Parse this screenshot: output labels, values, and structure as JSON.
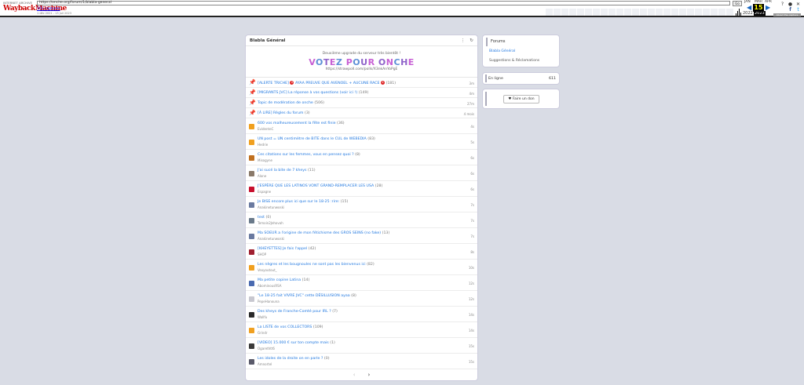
{
  "wayback": {
    "logo_small": "INTERNET ARCHIVE",
    "logo_big": "WaybackMachine",
    "url": "https://onche.org/forum/1/blabla-general",
    "go": "Go",
    "captures": "161 captures",
    "range": "1 déc 2021 - 13 Juil 2023",
    "months": [
      "JAN",
      "MAR",
      "APR"
    ],
    "day": "15",
    "year_prev": "2022",
    "year_cur": "2023",
    "about": "About this capture"
  },
  "forum": {
    "title": "Blabla Général",
    "banner_sub": "Deuxième upgrade du serveur très bientôt !",
    "vote_text": "VOTEZ POUR ONCHE",
    "vote_link": "https://strawpoll.com/polls/X3nkAnYoPgE",
    "pinned": [
      {
        "title": "[ALERTE TRICHE]",
        "badge": "X",
        "title2": "AYAA PREUVE QUE AVENOEL + AUCUNE RACE",
        "badge2": "X",
        "count": "(181)",
        "time": "3m",
        "pin": "green"
      },
      {
        "title": "[MIGRANTS JVC] La réponse à vos questions (voir ici !)",
        "count": "(149)",
        "time": "4m",
        "pin": "green"
      },
      {
        "title": "Topic de modération de onche",
        "count": "(506)",
        "time": "27m",
        "pin": "green"
      },
      {
        "title": "[À LIRE] Règles du forum",
        "count": "(3)",
        "time": "4 mois",
        "pin": "red"
      }
    ],
    "topics": [
      {
        "title": "600 vos malheureusement la fête est finie",
        "count": "(36)",
        "author": "EvidenteC",
        "time": "4s",
        "color": "#f0a020"
      },
      {
        "title": "UN post = UN centimètre de BITE dans le CUL de WEBEDIA",
        "count": "(83)",
        "author": "Hedrie",
        "time": "5s",
        "color": "#f0a020"
      },
      {
        "title": "Ces citations sur les femmes, vous en pensez quoi ?",
        "count": "(8)",
        "author": "Misogyne",
        "time": "6s",
        "color": "#c07020"
      },
      {
        "title": "J'ai sucé la bite de 7 kheys",
        "count": "(11)",
        "author": "Alone",
        "time": "6s",
        "color": "#8a7a6a"
      },
      {
        "title": "J'ESPÈRE QUE LES LATINOS VONT GRAND-REMPLACER LES USA",
        "count": "(28)",
        "author": "Espagne",
        "time": "6s",
        "color": "#c8102e"
      },
      {
        "title": "Je BISE encore plus ici que sur le 18-25 :rire:",
        "count": "(15)",
        "author": "Anakinetunwoski",
        "time": "7s",
        "color": "#6a7aa0"
      },
      {
        "title": "test",
        "count": "(0)",
        "author": "Temoin2Jehovah",
        "time": "7s",
        "color": "#6a7a8a"
      },
      {
        "title": "Ma SOEUR a l'origine de mon fétichisme des GROS SEINS (no fake)",
        "count": "(13)",
        "author": "Anakinetunwoski",
        "time": "7s",
        "color": "#6a7aa0"
      },
      {
        "title": "[KHEYETTES] Je fais l'appel",
        "count": "(42)",
        "author": "SHOP",
        "time": "8s",
        "color": "#a02030"
      },
      {
        "title": "Les nègres et les bougnoules ne sont pas les bienvenus ici",
        "count": "(82)",
        "author": "Vexyoutout_",
        "time": "10s",
        "color": "#f0a020"
      },
      {
        "title": "Ma petite copine Latina",
        "count": "(14)",
        "author": "AbominousRSA",
        "time": "12s",
        "color": "#4a6ab0"
      },
      {
        "title": "\"Le 18-25 fait VIVRE JVC\" cette DÉSILLUSION ayaa",
        "count": "(8)",
        "author": "PepeHanouna",
        "time": "12s",
        "color": "#c8c8d0"
      },
      {
        "title": "Des kheys de Franche-Comté pour IRL ?",
        "count": "(7)",
        "author": "Wallfu",
        "time": "14s",
        "color": "#2a2a2a"
      },
      {
        "title": "La LISTE de vos COLLECTORS",
        "count": "(109)",
        "author": "Grindr",
        "time": "14s",
        "color": "#f0a020"
      },
      {
        "title": "[VIDEO] 15.000 € sur ton compte mais",
        "count": "(1)",
        "author": "Ogarethtt6",
        "time": "15s",
        "color": "#3a3a3a"
      },
      {
        "title": "Les idoles de la droite on en parle ?",
        "count": "(0)",
        "author": "Amnortel",
        "time": "15s",
        "color": "#5a5a6a"
      }
    ],
    "pager_prev": "‹",
    "pager_next": "›"
  },
  "sidebar": {
    "forums_title": "Forums",
    "link1": "Blabla Général",
    "link2": "Suggestions & Réclamations",
    "online_label": "En ligne",
    "online_count": "611",
    "donate": "Faire un don"
  }
}
